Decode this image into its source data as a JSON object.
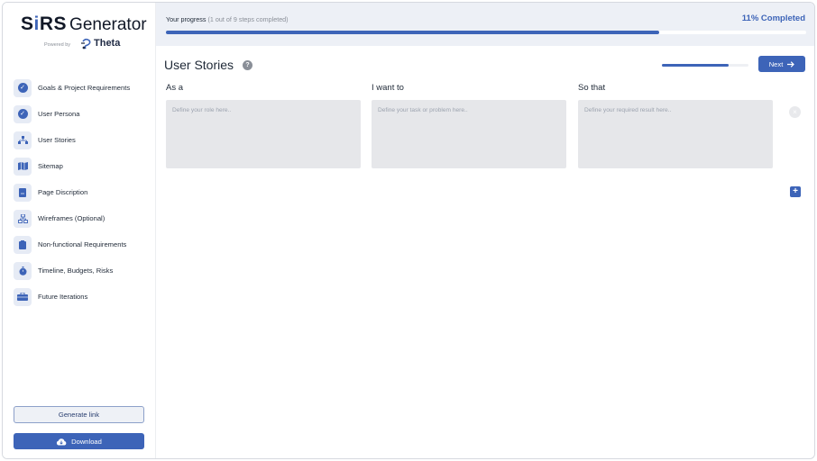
{
  "app": {
    "logo_srs_s": "S",
    "logo_srs_i": "i",
    "logo_srs_rest": "RS",
    "logo_generator": "Generator",
    "powered_by": "Powered by",
    "brand": "Theta"
  },
  "sidebar": {
    "items": [
      {
        "label": "Goals & Project Requirements",
        "icon": "check-circle-icon",
        "completed": true
      },
      {
        "label": "User Persona",
        "icon": "check-circle-icon",
        "completed": true
      },
      {
        "label": "User Stories",
        "icon": "sitemap-icon",
        "completed": false
      },
      {
        "label": "Sitemap",
        "icon": "map-icon",
        "completed": false
      },
      {
        "label": "Page Discription",
        "icon": "document-icon",
        "completed": false
      },
      {
        "label": "Wireframes (Optional)",
        "icon": "hierarchy-icon",
        "completed": false
      },
      {
        "label": "Non-functional Requirements",
        "icon": "clipboard-icon",
        "completed": false
      },
      {
        "label": "Timeline, Budgets, Risks",
        "icon": "stopwatch-icon",
        "completed": false
      },
      {
        "label": "Future Iterations",
        "icon": "toolbox-icon",
        "completed": false
      }
    ],
    "generate_link": "Generate link",
    "download": "Download"
  },
  "progress": {
    "label": "Your progress",
    "detail": "(1 out of 9 steps completed)",
    "percent_text": "11% Completed",
    "bar_fraction": 0.77
  },
  "main": {
    "title": "User Stories",
    "help": "?",
    "section_fraction": 0.77,
    "next_label": "Next",
    "columns": [
      {
        "label": "As a",
        "placeholder": "Define your role here..",
        "value": ""
      },
      {
        "label": "I want to",
        "placeholder": "Define your task or problem here..",
        "value": ""
      },
      {
        "label": "So that",
        "placeholder": "Define your required result here..",
        "value": ""
      }
    ],
    "remove": "×",
    "add": "+"
  },
  "colors": {
    "accent": "#3d64b8",
    "field_bg": "#e6e7ea",
    "topbar_bg": "#edf0f6"
  }
}
